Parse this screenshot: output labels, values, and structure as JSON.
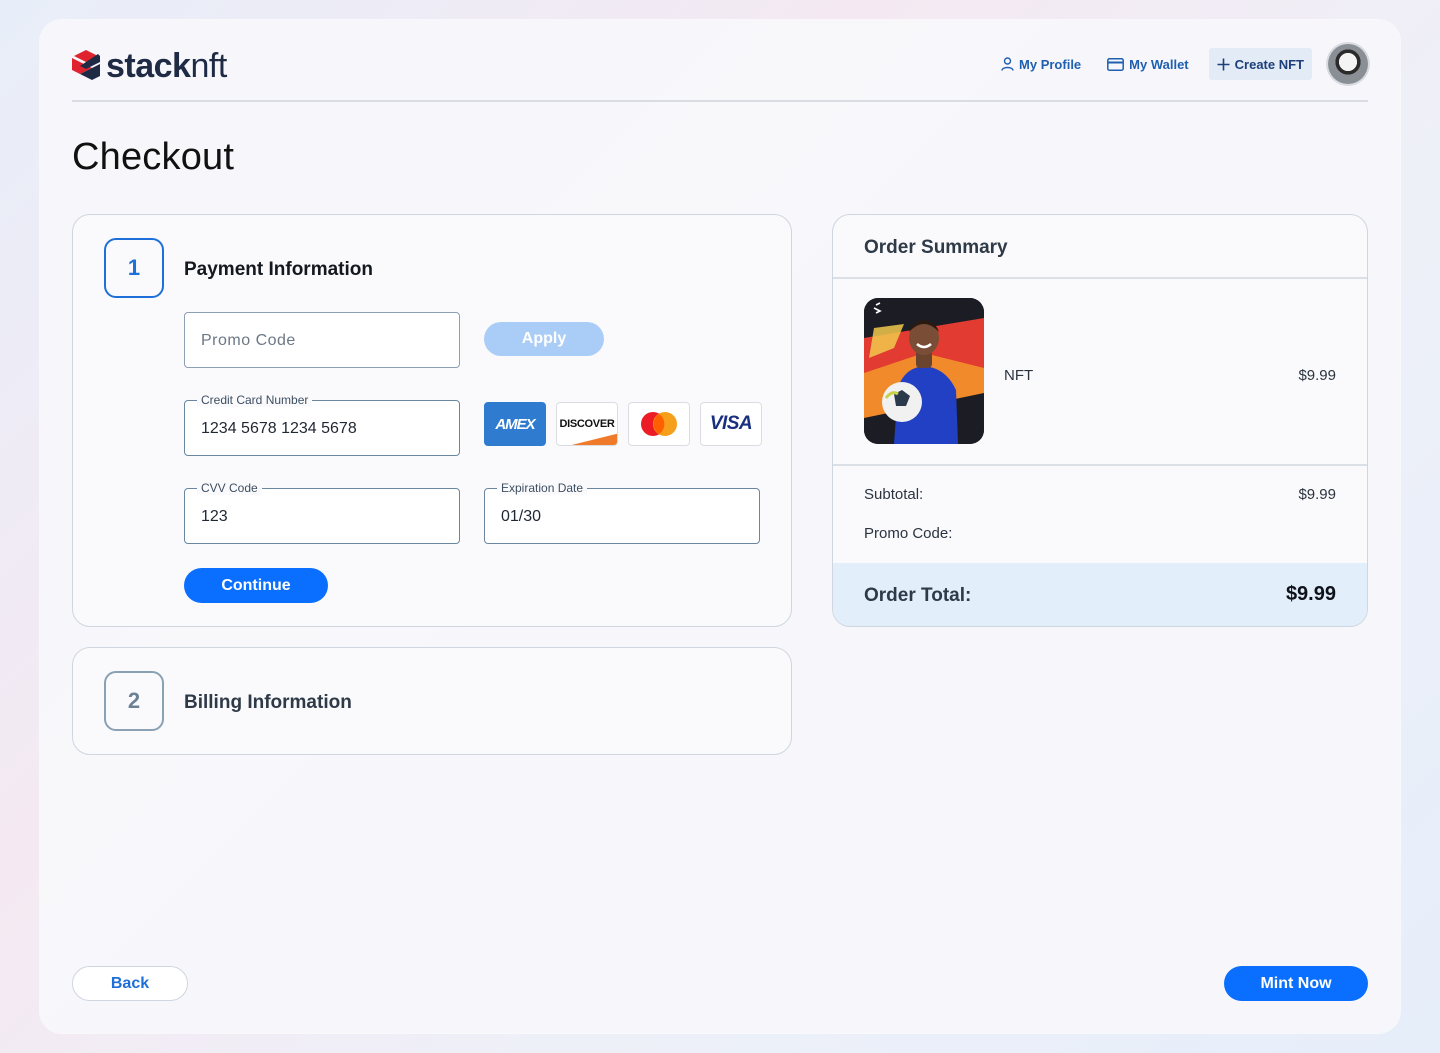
{
  "brand": {
    "name_bold": "stack",
    "name_light": "nft",
    "accent": "#e0242f"
  },
  "nav": {
    "profile": "My Profile",
    "wallet": "My Wallet",
    "create": "Create NFT"
  },
  "page": {
    "title": "Checkout"
  },
  "payment": {
    "step_number": "1",
    "title": "Payment Information",
    "promo_placeholder": "Promo Code",
    "apply_label": "Apply",
    "card_number_label": "Credit Card Number",
    "card_number_value": "1234 5678 1234 5678",
    "cvv_label": "CVV Code",
    "cvv_value": "123",
    "expiration_label": "Expiration Date",
    "expiration_value": "01/30",
    "continue_label": "Continue",
    "card_brands": {
      "amex": "AMEX",
      "discover": "DISCOVER",
      "mastercard": "mastercard-logo",
      "visa": "VISA"
    }
  },
  "billing": {
    "step_number": "2",
    "title": "Billing Information"
  },
  "summary": {
    "title": "Order Summary",
    "item_name": "NFT",
    "item_price": "$9.99",
    "subtotal_label": "Subtotal:",
    "subtotal_value": "$9.99",
    "promo_label": "Promo Code:",
    "promo_value": "",
    "total_label": "Order Total:",
    "total_value": "$9.99"
  },
  "footer": {
    "back_label": "Back",
    "mint_label": "Mint Now"
  },
  "colors": {
    "primary": "#0a6fff",
    "apply_disabled": "#a9cdf7",
    "total_band": "#e3eefb"
  }
}
